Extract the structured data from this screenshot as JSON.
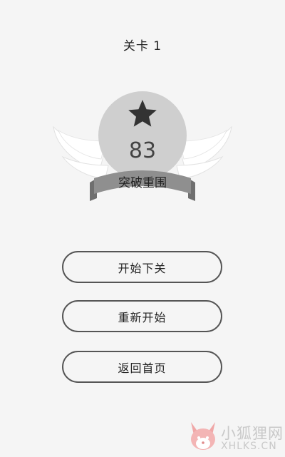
{
  "header": {
    "level_title": "关卡 1"
  },
  "result": {
    "score": "83",
    "title": "突破重围"
  },
  "buttons": {
    "next_level": "开始下关",
    "restart": "重新开始",
    "home": "返回首页"
  },
  "watermark": {
    "cn": "小狐狸网",
    "en": "XHLKS.CN"
  },
  "colors": {
    "background": "#f5f5f5",
    "badge_circle": "#cfcfcf",
    "ribbon": "#8f8f8f",
    "ribbon_dark": "#6f6f6f",
    "star": "#333333",
    "wing": "#ffffff",
    "button_border": "#555555"
  }
}
